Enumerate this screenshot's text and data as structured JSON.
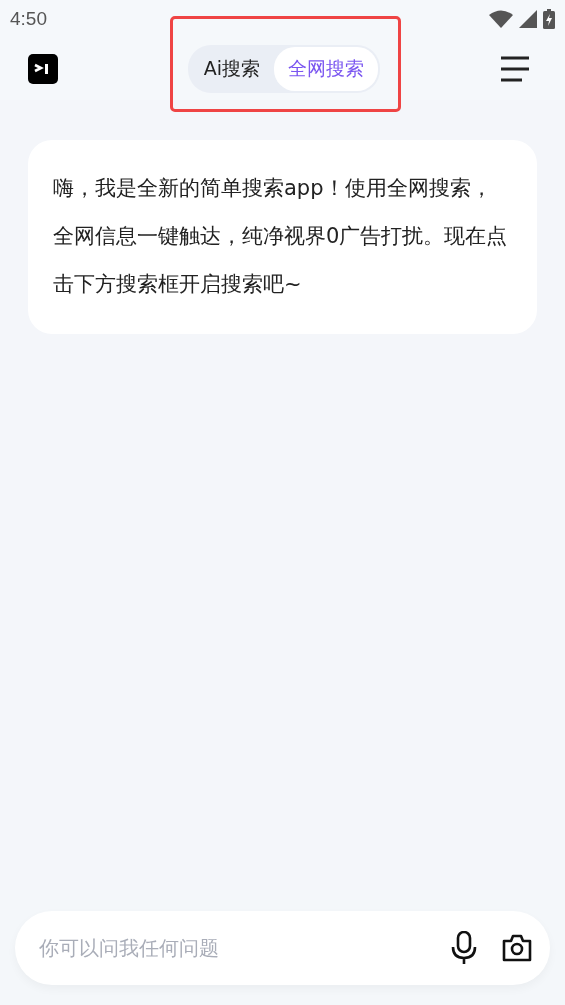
{
  "status_bar": {
    "time": "4:50"
  },
  "header": {
    "tabs": [
      {
        "label": "Ai搜索",
        "selected": false
      },
      {
        "label": "全网搜索",
        "selected": true
      }
    ],
    "tabs_highlighted": true
  },
  "messages": [
    {
      "text": "嗨，我是全新的简单搜索app！使用全网搜索，全网信息一键触达，纯净视界0广告打扰。现在点击下方搜索框开启搜索吧~"
    }
  ],
  "input": {
    "placeholder": "你可以问我任何问题"
  }
}
